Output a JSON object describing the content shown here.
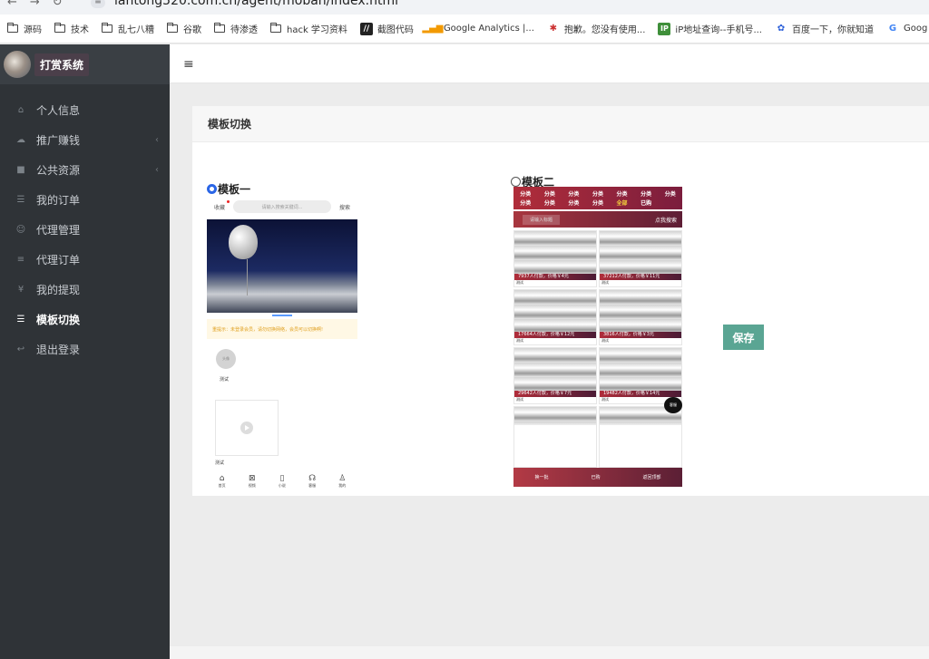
{
  "browser": {
    "nav_icons": "←→↻",
    "site_icon": "≡",
    "url": "lantong520.com.cn/agent/moban/index.html",
    "bookmarks": [
      {
        "label": "源码",
        "icon": "folder-icon"
      },
      {
        "label": "技术",
        "icon": "folder-icon"
      },
      {
        "label": "乱七八糟",
        "icon": "folder-icon"
      },
      {
        "label": "谷歌",
        "icon": "folder-icon"
      },
      {
        "label": "待渗透",
        "icon": "folder-icon"
      },
      {
        "label": "hack 学习资料",
        "icon": "folder-icon"
      },
      {
        "label": "截图代码",
        "icon": "slash-icon"
      },
      {
        "label": "Google Analytics |...",
        "icon": "analytics-icon"
      },
      {
        "label": "抱歉。您没有使用...",
        "icon": "bug-icon"
      },
      {
        "label": "iP地址查询--手机号...",
        "icon": "map-icon"
      },
      {
        "label": "百度一下，你就知道",
        "icon": "paw-icon"
      },
      {
        "label": "Goog",
        "icon": "google-icon"
      }
    ]
  },
  "sidebar": {
    "brand": "打赏系统",
    "items": [
      {
        "label": "个人信息",
        "icon": "home-icon",
        "icon_glyph": "⌂",
        "caret": ""
      },
      {
        "label": "推广赚钱",
        "icon": "cloud-icon",
        "icon_glyph": "☁",
        "caret": "‹"
      },
      {
        "label": "公共资源",
        "icon": "video-icon",
        "icon_glyph": "■",
        "caret": "‹"
      },
      {
        "label": "我的订单",
        "icon": "list-icon",
        "icon_glyph": "☰",
        "caret": ""
      },
      {
        "label": "代理管理",
        "icon": "users-icon",
        "icon_glyph": "☺",
        "caret": ""
      },
      {
        "label": "代理订单",
        "icon": "bars-icon",
        "icon_glyph": "≡",
        "caret": ""
      },
      {
        "label": "我的提现",
        "icon": "yen-icon",
        "icon_glyph": "¥",
        "caret": ""
      },
      {
        "label": "模板切换",
        "icon": "list-icon",
        "icon_glyph": "☰",
        "caret": "",
        "active": true
      },
      {
        "label": "退出登录",
        "icon": "reply-icon",
        "icon_glyph": "↩",
        "caret": ""
      }
    ]
  },
  "topbar": {
    "menu_icon": "≡"
  },
  "panel": {
    "title": "模板切换",
    "save_label": "保存"
  },
  "template1": {
    "label": "模板一",
    "selected": true,
    "top_left": "收藏",
    "search_placeholder": "请输入搜索关键词...",
    "search_btn": "搜索",
    "notice": "重提示：未登录会员，请勿切换网络，会员可以切换啊!",
    "avatar_text": "头像",
    "avatar_caption": "测试",
    "video_caption": "测试",
    "tabs": [
      {
        "label": "首页",
        "glyph": "⌂",
        "icon": "home-icon"
      },
      {
        "label": "视频",
        "glyph": "⊠",
        "icon": "video-grid-icon"
      },
      {
        "label": "小说",
        "glyph": "▯",
        "icon": "book-icon"
      },
      {
        "label": "客服",
        "glyph": "☊",
        "icon": "headset-icon"
      },
      {
        "label": "我的",
        "glyph": "♙",
        "icon": "user-icon"
      }
    ]
  },
  "template2": {
    "label": "模板二",
    "selected": false,
    "categories": [
      "分类",
      "分类",
      "分类",
      "分类",
      "分类",
      "分类",
      "分类",
      "分类",
      "分类",
      "分类",
      "分类",
      "全部",
      "已购",
      ""
    ],
    "search_placeholder": "请输入标题",
    "search_btn": "点我搜索",
    "cards": [
      {
        "bar": "7937人付款，价格￥4元",
        "name": "测试"
      },
      {
        "bar": "37212人付款，价格￥11元",
        "name": "测试"
      },
      {
        "bar": "17664人付款，价格￥12元",
        "name": "测试"
      },
      {
        "bar": "3816人付款，价格￥3元",
        "name": "测试"
      },
      {
        "bar": "29642人付款，价格￥7元",
        "name": "测试"
      },
      {
        "bar": "19482人付款，价格￥14元",
        "name": "测试"
      },
      {
        "bar": "",
        "name": ""
      },
      {
        "bar": "",
        "name": ""
      }
    ],
    "float_btn": "客服",
    "bottom": [
      "换一批",
      "已购",
      "返回顶部"
    ]
  }
}
